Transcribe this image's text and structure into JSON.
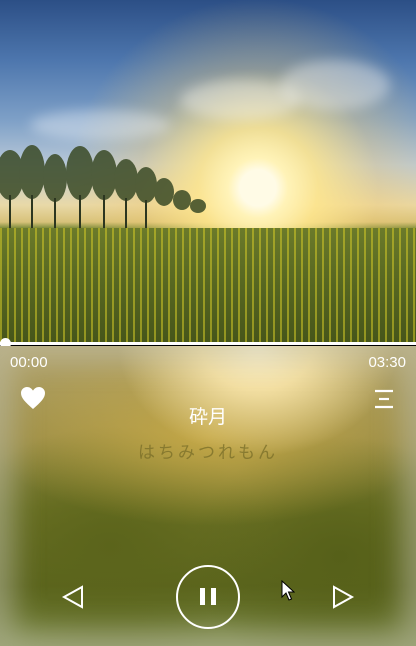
{
  "player": {
    "current_time": "00:00",
    "duration": "03:30",
    "progress": 0.0,
    "title": "砕月",
    "lyric": "はちみつれもん",
    "liked": true
  },
  "colors": {
    "foreground": "#ffffff",
    "lyric_dim": "#786e28"
  },
  "icons": {
    "favorite": "heart-icon",
    "playlist": "menu-icon",
    "previous": "previous-icon",
    "pause": "pause-icon",
    "next": "next-icon"
  }
}
